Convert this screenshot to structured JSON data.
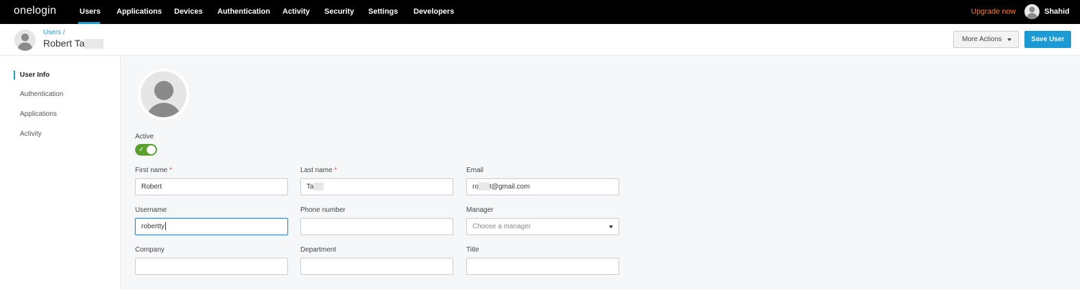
{
  "brand": {
    "logo_text": "onelogin",
    "accent": "#1c9ad6",
    "upgrade_color": "#f47c20",
    "active_toggle": "#5aa02c"
  },
  "nav": {
    "items": [
      {
        "label": "Users",
        "active": true
      },
      {
        "label": "Applications"
      },
      {
        "label": "Devices"
      },
      {
        "label": "Authentication"
      },
      {
        "label": "Activity"
      },
      {
        "label": "Security"
      },
      {
        "label": "Settings"
      },
      {
        "label": "Developers"
      }
    ],
    "upgrade_label": "Upgrade now",
    "user_name": "Shahid"
  },
  "header": {
    "breadcrumb": "Users",
    "breadcrumb_sep": "/",
    "title": "Robert Ta",
    "more_actions_label": "More Actions",
    "save_label": "Save User"
  },
  "sidebar": {
    "items": [
      {
        "label": "User Info",
        "active": true
      },
      {
        "label": "Authentication"
      },
      {
        "label": "Applications"
      },
      {
        "label": "Activity"
      }
    ]
  },
  "form": {
    "active_label": "Active",
    "active": true,
    "first_name": {
      "label": "First name",
      "required": "*",
      "value": "Robert"
    },
    "last_name": {
      "label": "Last name",
      "required": "*",
      "value": "Ta"
    },
    "email": {
      "label": "Email",
      "value_prefix": "ro",
      "value_suffix": "t@gmail.com"
    },
    "username": {
      "label": "Username",
      "value": "robertty"
    },
    "phone": {
      "label": "Phone number",
      "value": ""
    },
    "manager": {
      "label": "Manager",
      "placeholder": "Choose a manager"
    },
    "company": {
      "label": "Company",
      "value": ""
    },
    "department": {
      "label": "Department",
      "value": ""
    },
    "title": {
      "label": "Title",
      "value": ""
    }
  }
}
